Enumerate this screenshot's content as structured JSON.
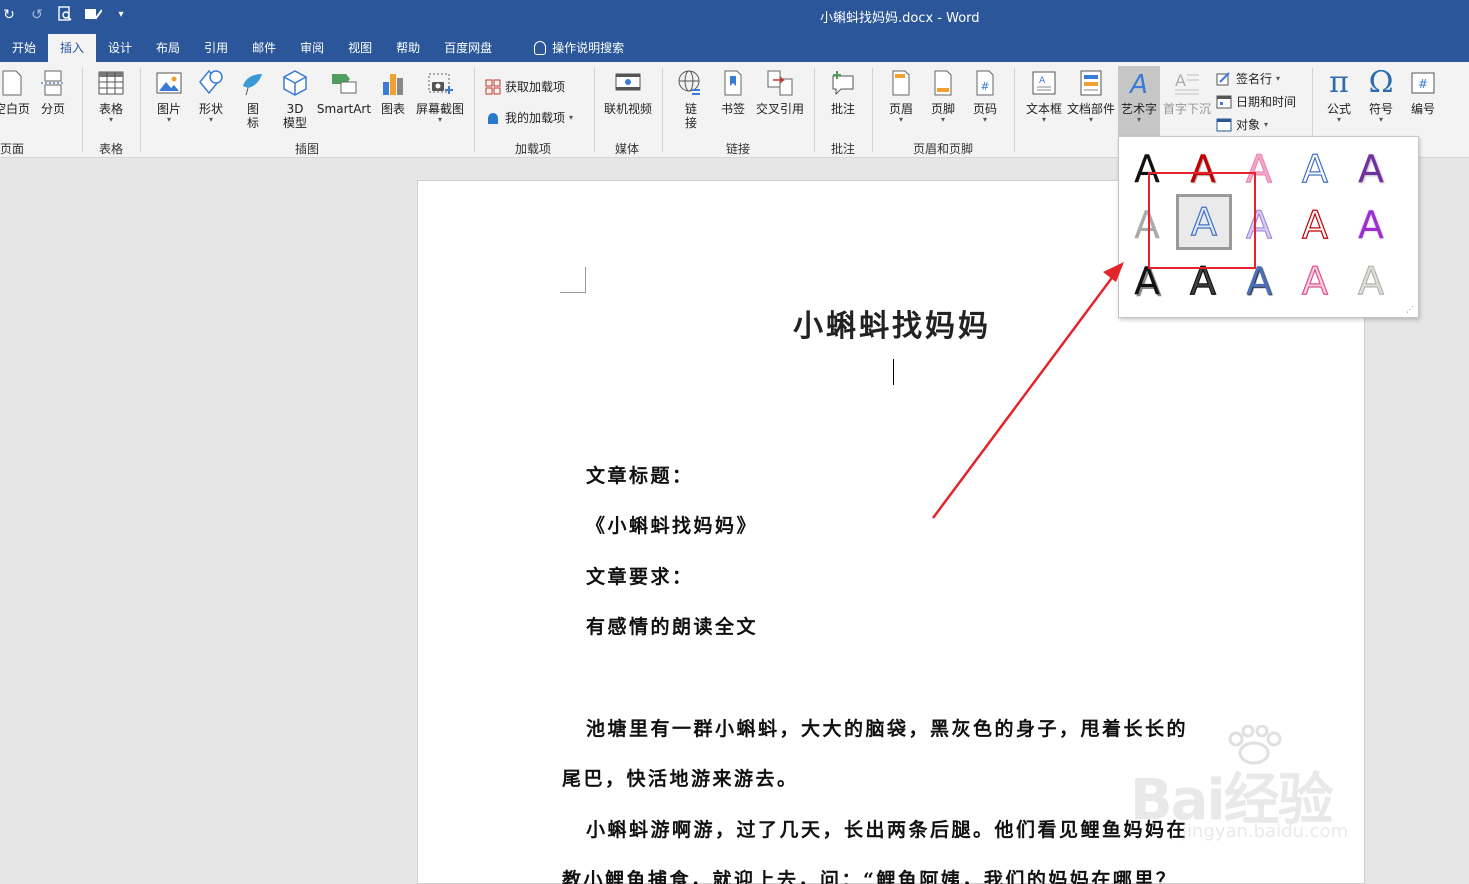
{
  "window": {
    "title": "小蝌蚪找妈妈.docx  -  Word"
  },
  "tabs": [
    {
      "label": "开始"
    },
    {
      "label": "插入"
    },
    {
      "label": "设计"
    },
    {
      "label": "布局"
    },
    {
      "label": "引用"
    },
    {
      "label": "邮件"
    },
    {
      "label": "审阅"
    },
    {
      "label": "视图"
    },
    {
      "label": "帮助"
    },
    {
      "label": "百度网盘"
    },
    {
      "label": "操作说明搜索"
    }
  ],
  "ribbon": {
    "blank_page": "空白页",
    "page_break": "分页",
    "pages_group": "页面",
    "table": "表格",
    "tables_group": "表格",
    "picture": "图片",
    "shape": "形状",
    "icon_l1": "图",
    "icon_l2": "标",
    "model_l1": "3D",
    "model_l2": "模型",
    "smartart": "SmartArt",
    "chart": "图表",
    "screenshot": "屏幕截图",
    "illustrations_group": "插图",
    "get_addins": "获取加载项",
    "my_addins": "我的加载项",
    "addins_group": "加载项",
    "online_video": "联机视频",
    "media_group": "媒体",
    "link_l1": "链",
    "link_l2": "接",
    "bookmark": "书签",
    "cross_ref": "交叉引用",
    "links_group": "链接",
    "comment": "批注",
    "comments_group": "批注",
    "header": "页眉",
    "footer": "页脚",
    "page_number": "页码",
    "hf_group": "页眉和页脚",
    "textbox": "文本框",
    "quick_parts": "文档部件",
    "wordart": "艺术字",
    "dropcap": "首字下沉",
    "signature": "签名行",
    "datetime": "日期和时间",
    "object": "对象",
    "equation": "公式",
    "symbol": "符号",
    "number": "编号"
  },
  "document": {
    "title": "小蝌蚪找妈妈",
    "lines": [
      "文章标题：",
      "《小蝌蚪找妈妈》",
      "文章要求：",
      "有感情的朗读全文",
      "池塘里有一群小蝌蚪，大大的脑袋，黑灰色的身子，甩着长长的",
      "尾巴，快活地游来游去。",
      "小蝌蚪游啊游，过了几天，长出两条后腿。他们看见鲤鱼妈妈在",
      "教小鲤鱼捕食，就迎上去，问：“鲤鱼阿姨，我们的妈妈在哪里？"
    ]
  },
  "gallery": {
    "glyph": "A",
    "colors": {
      "blue": "#4472c4",
      "red": "#c00000",
      "pink": "#e97fae",
      "purple": "#7030a0",
      "gray": "#8c8c8c"
    }
  },
  "watermark": {
    "brand": "Bai经验",
    "url": "jingyan.baidu.com"
  }
}
